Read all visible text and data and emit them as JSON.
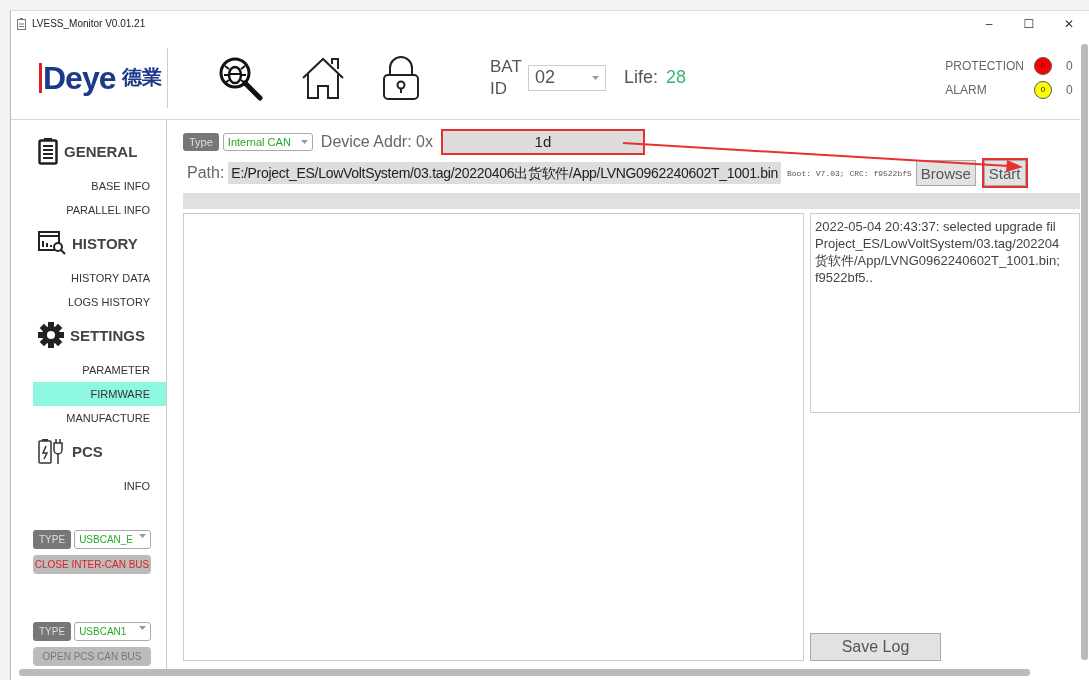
{
  "window": {
    "title": "LVESS_Monitor V0.01.21",
    "controls": [
      "–",
      "☐",
      "✕"
    ]
  },
  "header": {
    "logo_text": "Deye",
    "logo_cn": "德業",
    "bat_id_label": "BAT ID",
    "bat_id_value": "02",
    "life_label": "Life:",
    "life_value": "28",
    "indicators": [
      {
        "label": "PROTECTION",
        "color": "#ff0000",
        "count": "0",
        "value": "0"
      },
      {
        "label": "ALARM",
        "color": "#ffff00",
        "count": "0",
        "value": "0"
      }
    ]
  },
  "sidebar": {
    "sections": [
      {
        "title": "GENERAL",
        "items": [
          {
            "label": "BASE INFO",
            "selected": false
          },
          {
            "label": "PARALLEL INFO",
            "selected": false
          }
        ]
      },
      {
        "title": "HISTORY",
        "items": [
          {
            "label": "HISTORY DATA",
            "selected": false
          },
          {
            "label": "LOGS HISTORY",
            "selected": false
          }
        ]
      },
      {
        "title": "SETTINGS",
        "items": [
          {
            "label": "PARAMETER",
            "selected": false
          },
          {
            "label": "FIRMWARE",
            "selected": true
          },
          {
            "label": "MANUFACTURE",
            "selected": false
          }
        ]
      },
      {
        "title": "PCS",
        "items": [
          {
            "label": "INFO",
            "selected": false
          }
        ]
      }
    ],
    "can_controls": [
      {
        "type_label": "TYPE",
        "type_value": "USBCAN_E",
        "button": "CLOSE INTER-CAN BUS",
        "active": true
      },
      {
        "type_label": "TYPE",
        "type_value": "USBCAN1",
        "button": "OPEN PCS CAN BUS",
        "active": false
      }
    ]
  },
  "firmware": {
    "type_label": "Type",
    "type_value": "Internal CAN",
    "device_addr_label": "Device Addr: 0x",
    "device_addr": "1d",
    "device_addr_highlighted": true,
    "path_label": "Path:",
    "path": "E:/Project_ES/LowVoltSystem/03.tag/20220406出货软件/App/LVNG0962240602T_1001.bin",
    "boot_info": "Boot: V7.03; CRC: f9522bf5",
    "browse": "Browse",
    "start": "Start",
    "start_highlighted": true,
    "progress": {
      "level": 0
    },
    "log_lines": [
      "2022-05-04 20:43:37: selected upgrade fil",
      "Project_ES/LowVoltSystem/03.tag/202204",
      "货软件/App/LVNG0962240602T_1001.bin;",
      "f9522bf5.."
    ],
    "save_log": "Save Log"
  }
}
